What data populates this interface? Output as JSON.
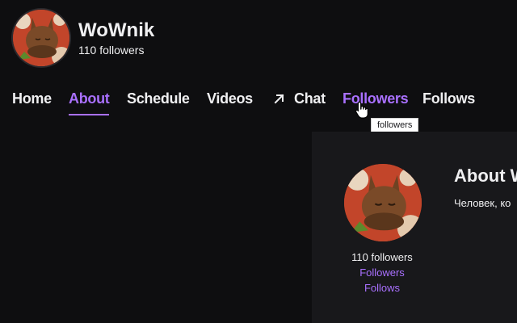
{
  "channel": {
    "name": "WoWnik",
    "followers": "110 followers"
  },
  "tabs": [
    {
      "label": "Home"
    },
    {
      "label": "About"
    },
    {
      "label": "Schedule"
    },
    {
      "label": "Videos"
    },
    {
      "label": "Chat"
    },
    {
      "label": "Followers"
    },
    {
      "label": "Follows"
    }
  ],
  "tooltip": "followers",
  "about": {
    "title": "About W",
    "description": "Человек, ко",
    "followers": "110 followers",
    "links": [
      "Followers",
      "Follows"
    ]
  },
  "colors": {
    "background": "#0e0e10",
    "panel": "#18181b",
    "accent": "#a970ff",
    "text": "#efeff1"
  },
  "icons": {
    "chat_tab": "external-link-arrow-icon",
    "cursor": "hand-pointer-icon"
  }
}
